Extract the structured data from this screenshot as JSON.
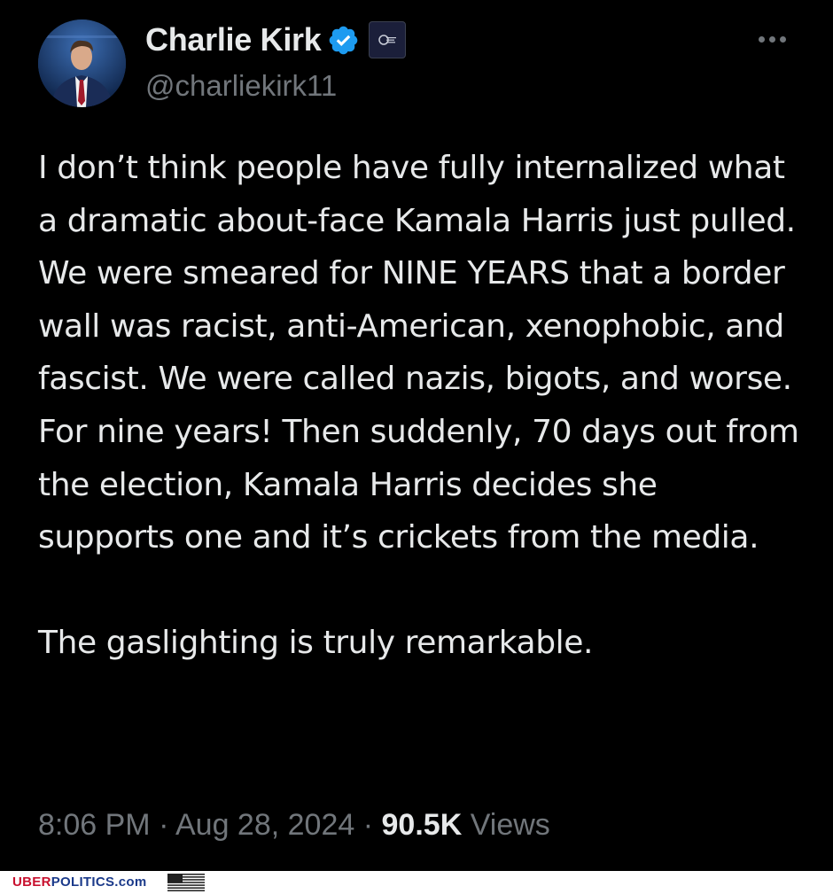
{
  "author": {
    "name": "Charlie Kirk",
    "handle": "@charliekirk11",
    "verified_color": "#1d9bf0"
  },
  "tweet": {
    "paragraph1": "I don’t think people have fully internalized what a dramatic about-face Kamala Harris just pulled. We were smeared for NINE YEARS that a border wall was racist, anti-American, xenophobic, and fascist. We were called nazis, bigots, and worse. For nine years! Then suddenly, 70 days out from the election, Kamala Harris decides she supports one and it’s crickets from the media.",
    "paragraph2": "The gaslighting is truly remarkable."
  },
  "meta": {
    "time": "8:06 PM",
    "date": "Aug 28, 2024",
    "separator": "·",
    "views_count": "90.5K",
    "views_label": "Views"
  },
  "icons": {
    "more": "more-options-icon",
    "verified": "verified-badge-icon",
    "affiliate": "organization-affiliate-icon"
  },
  "footer": {
    "brand_uber": "UBER",
    "brand_politics": "POLITICS.com"
  }
}
